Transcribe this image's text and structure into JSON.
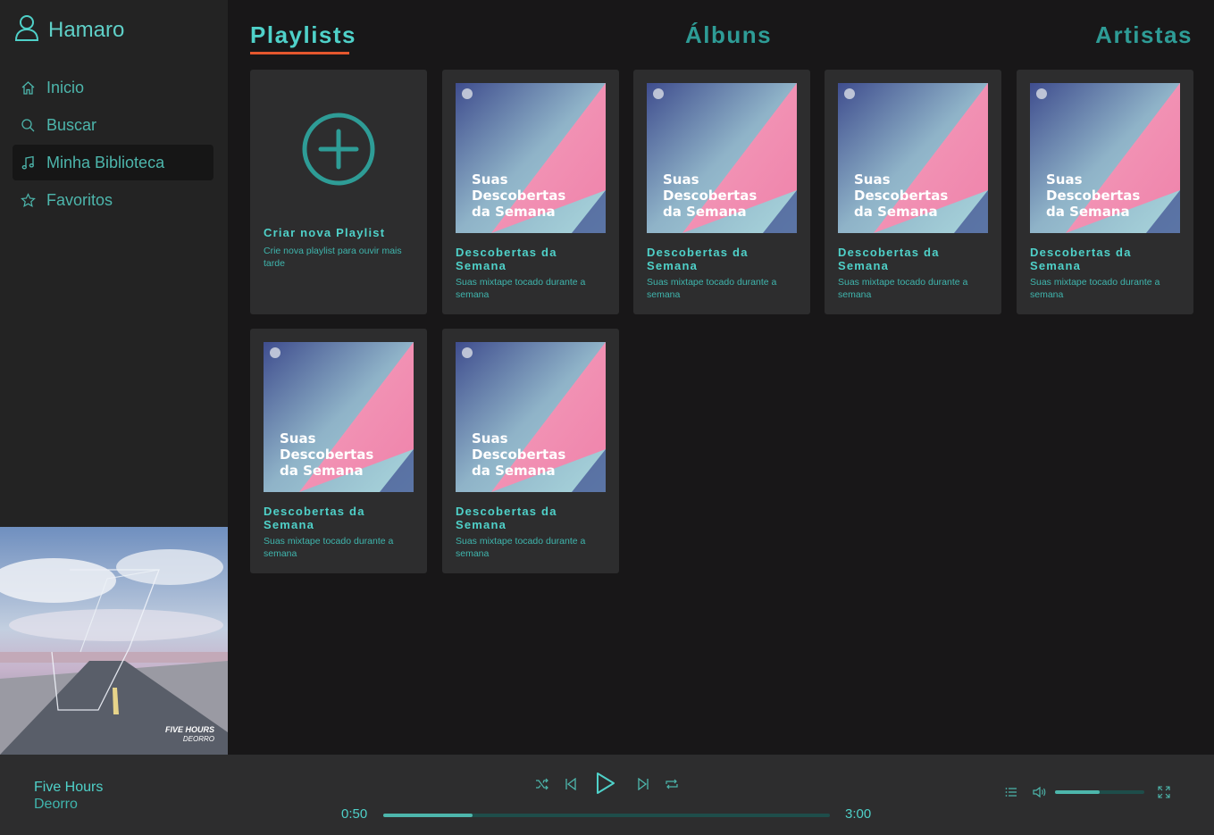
{
  "colors": {
    "accent": "#4fd1c9",
    "tab_underline": "#e4572e",
    "sidebar_bg": "#232323",
    "main_bg": "#181718",
    "card_bg": "#2d2d2e"
  },
  "user": {
    "name": "Hamaro",
    "icon": "user-icon"
  },
  "nav": [
    {
      "label": "Inicio",
      "icon": "home-icon"
    },
    {
      "label": "Buscar",
      "icon": "search-icon"
    },
    {
      "label": "Minha Biblioteca",
      "icon": "music-note-icon",
      "active": true
    },
    {
      "label": "Favoritos",
      "icon": "star-icon"
    }
  ],
  "tabs": [
    {
      "label": "Playlists",
      "active": true
    },
    {
      "label": "Álbuns"
    },
    {
      "label": "Artistas"
    }
  ],
  "create_card": {
    "title": "Criar nova Playlist",
    "desc": "Crie nova playlist para ouvir mais tarde",
    "icon": "plus-circle-icon"
  },
  "playlists": [
    {
      "cover_text": [
        "Suas",
        "Descobertas",
        "da Semana"
      ],
      "title": "Descobertas da Semana",
      "desc": "Suas mixtape tocado durante a semana"
    },
    {
      "cover_text": [
        "Suas",
        "Descobertas",
        "da Semana"
      ],
      "title": "Descobertas da Semana",
      "desc": "Suas mixtape tocado durante a semana"
    },
    {
      "cover_text": [
        "Suas",
        "Descobertas",
        "da Semana"
      ],
      "title": "Descobertas da Semana",
      "desc": "Suas mixtape tocado durante a semana"
    },
    {
      "cover_text": [
        "Suas",
        "Descobertas",
        "da Semana"
      ],
      "title": "Descobertas da Semana",
      "desc": "Suas mixtape tocado durante a semana"
    },
    {
      "cover_text": [
        "Suas",
        "Descobertas",
        "da Semana"
      ],
      "title": "Descobertas da Semana",
      "desc": "Suas mixtape tocado durante a semana"
    },
    {
      "cover_text": [
        "Suas",
        "Descobertas",
        "da Semana"
      ],
      "title": "Descobertas da Semana",
      "desc": "Suas mixtape tocado durante a semana"
    }
  ],
  "now_playing": {
    "art_text": [
      "FIVE HOURS",
      "DEORRO"
    ],
    "title": "Five Hours",
    "artist": "Deorro",
    "elapsed": "0:50",
    "duration": "3:00",
    "progress": 0.2,
    "volume": 0.5
  },
  "controls": {
    "shuffle": "shuffle-icon",
    "previous": "skip-previous-icon",
    "play": "play-icon",
    "next": "skip-next-icon",
    "repeat": "repeat-icon",
    "queue": "queue-list-icon",
    "volume": "volume-icon",
    "fullscreen": "fullscreen-icon"
  }
}
